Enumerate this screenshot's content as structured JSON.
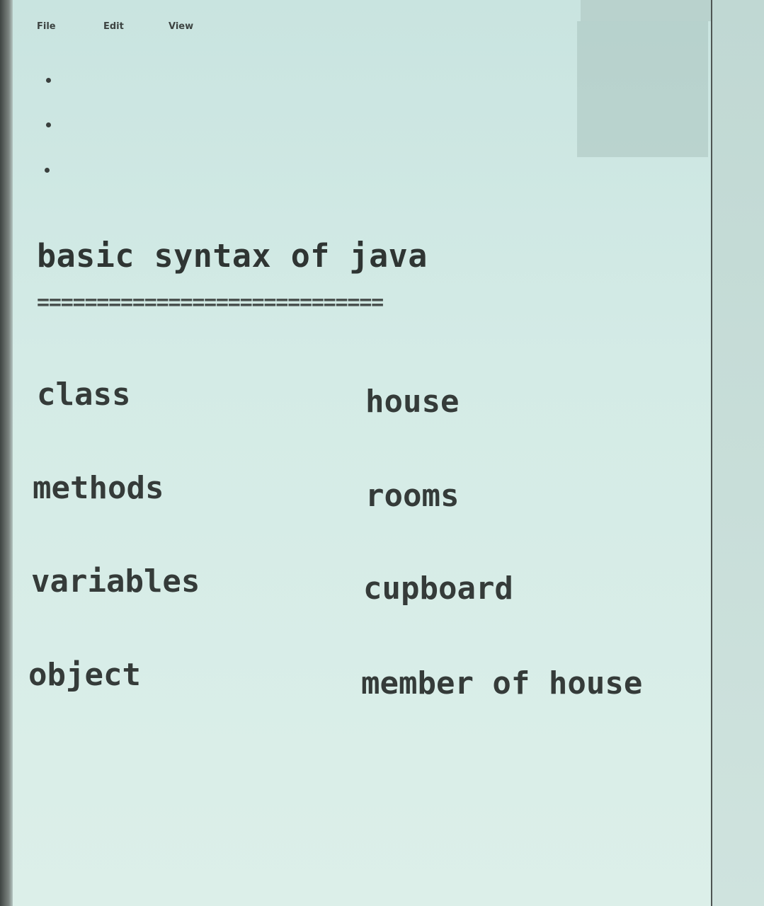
{
  "menu": {
    "file": "File",
    "edit": "Edit",
    "view": "View"
  },
  "document": {
    "bullets": [
      "•",
      "•",
      "•"
    ],
    "heading": "basic syntax of java",
    "underline": "=============================",
    "rows": [
      {
        "term": "class",
        "analogy": "house"
      },
      {
        "term": "methods",
        "analogy": "rooms"
      },
      {
        "term": "variables",
        "analogy": "cupboard"
      },
      {
        "term": "object",
        "analogy": "member of house"
      }
    ]
  }
}
